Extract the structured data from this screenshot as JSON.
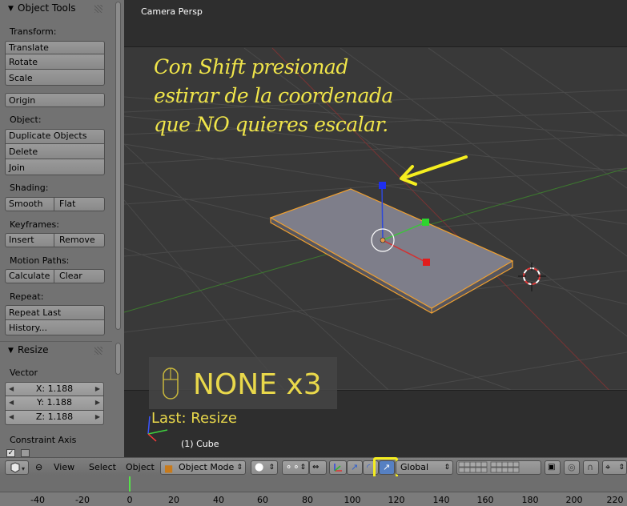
{
  "toolshelf": {
    "object_tools_title": "Object Tools",
    "transform_label": "Transform:",
    "translate": "Translate",
    "rotate": "Rotate",
    "scale": "Scale",
    "origin": "Origin",
    "object_label": "Object:",
    "duplicate": "Duplicate Objects",
    "delete": "Delete",
    "join": "Join",
    "shading_label": "Shading:",
    "smooth": "Smooth",
    "flat": "Flat",
    "keyframes_label": "Keyframes:",
    "insert": "Insert",
    "remove": "Remove",
    "motion_paths_label": "Motion Paths:",
    "calculate": "Calculate",
    "clear": "Clear",
    "repeat_label": "Repeat:",
    "repeat_last": "Repeat Last",
    "history": "History...",
    "resize_title": "Resize",
    "vector_label": "Vector",
    "x": "X: 1.188",
    "y": "Y: 1.188",
    "z": "Z: 1.188",
    "constraint_label": "Constraint Axis"
  },
  "viewport": {
    "title": "Camera Persp",
    "annotation": "Con Shift presionad\nestirar de la coordenada\nque NO quieres escalar.",
    "keycast": "NONE x3",
    "last_op": "Last: Resize",
    "object_name": "(1) Cube"
  },
  "header": {
    "view": "View",
    "select": "Select",
    "object": "Object",
    "mode": "Object Mode",
    "orientation": "Global"
  },
  "timeline": {
    "ticks": [
      "-40",
      "-20",
      "0",
      "20",
      "40",
      "60",
      "80",
      "100",
      "120",
      "140",
      "160",
      "180",
      "200",
      "220"
    ]
  },
  "colors": {
    "annotation": "#f0e54a",
    "highlight": "#f5ee1f",
    "selection_outline": "#f0a030"
  }
}
